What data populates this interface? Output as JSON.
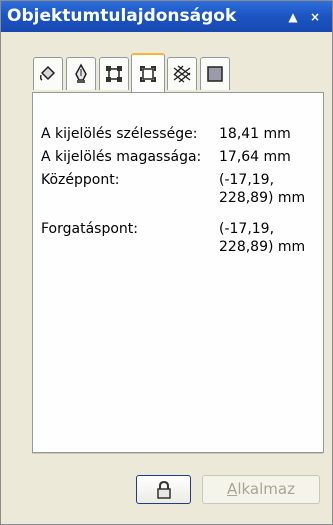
{
  "window": {
    "title": "Objektumtulajdonságok",
    "minimize_glyph": "▲",
    "close_glyph": "×"
  },
  "tabs": [
    {
      "icon": "fill-bucket-icon",
      "active": false
    },
    {
      "icon": "pen-nib-icon",
      "active": false
    },
    {
      "icon": "bounding-box-icon",
      "active": false
    },
    {
      "icon": "bounding-box-corners-icon",
      "active": true
    },
    {
      "icon": "hatch-icon",
      "active": false
    },
    {
      "icon": "square-icon",
      "active": false
    }
  ],
  "properties": [
    {
      "label": "A kijelölés szélessége:",
      "value": "18,41 mm"
    },
    {
      "label": "A kijelölés magassága:",
      "value": "17,64 mm"
    },
    {
      "label": "Középpont:",
      "value_line1": "(-17,19,",
      "value_line2": "228,89) mm"
    },
    {
      "label": "Forgatáspont:",
      "value_line1": "(-17,19,",
      "value_line2": "228,89) mm"
    }
  ],
  "buttons": {
    "lock_icon": "lock-icon",
    "apply_prefix": "A",
    "apply_rest": "lkalmaz",
    "apply_enabled": false
  }
}
